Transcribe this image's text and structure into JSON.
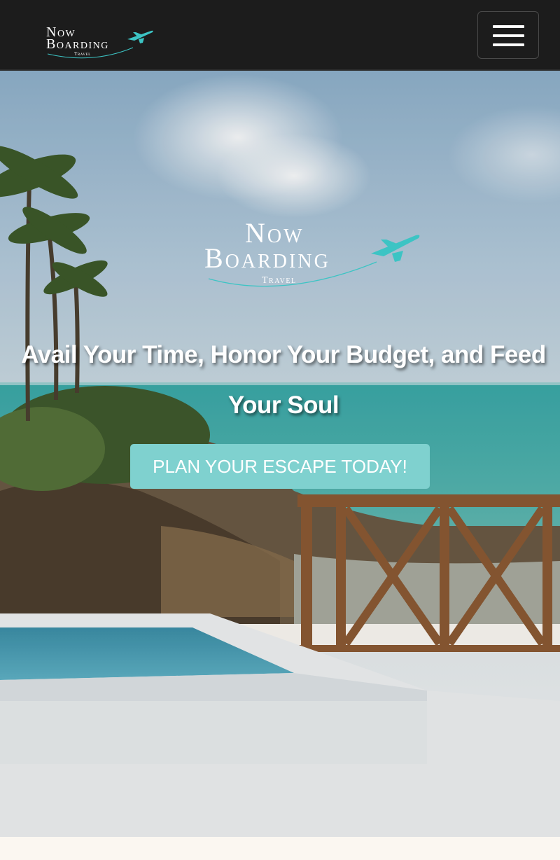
{
  "brand": {
    "line1": "Now",
    "line2": "Boarding",
    "line3": "Travel",
    "accent_color": "#3cc4c4"
  },
  "nav": {
    "menu_icon": "hamburger-icon"
  },
  "hero": {
    "headline": "Avail Your Time, Honor Your Budget, and Feed Your Soul",
    "cta_label": "PLAN YOUR ESCAPE TODAY!",
    "cta_color": "#7fd1cf",
    "background": "tropical-beach-pool-photo"
  }
}
